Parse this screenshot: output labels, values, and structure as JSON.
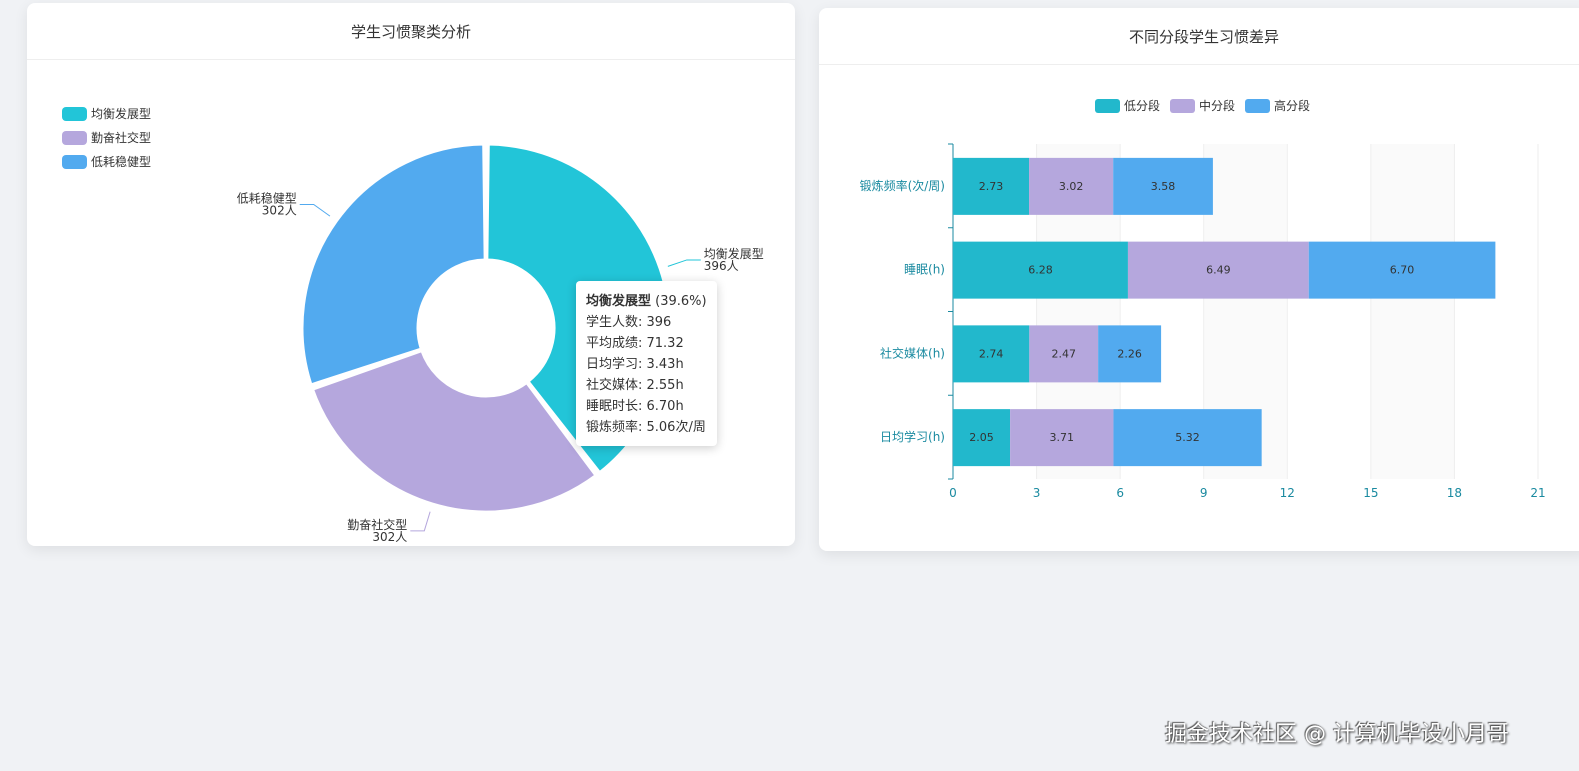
{
  "watermark": "掘金技术社区 @ 计算机毕设小月哥",
  "chart_data": [
    {
      "type": "pie",
      "title": "学生习惯聚类分析",
      "legend_position": "top-left",
      "slices": [
        {
          "name": "均衡发展型",
          "value": 396,
          "label": "396人",
          "color": "#22c5d8"
        },
        {
          "name": "勤奋社交型",
          "value": 302,
          "label": "302人",
          "color": "#b5a7dd"
        },
        {
          "name": "低耗稳健型",
          "value": 302,
          "label": "302人",
          "color": "#52aaef"
        }
      ],
      "tooltip": {
        "title": "均衡发展型",
        "percent": "(39.6%)",
        "lines": [
          "学生人数: 396",
          "平均成绩: 71.32",
          "日均学习: 3.43h",
          "社交媒体: 2.55h",
          "睡眠时长: 6.70h",
          "锻炼频率: 5.06次/周"
        ]
      }
    },
    {
      "type": "bar",
      "stacked": true,
      "orientation": "horizontal",
      "title": "不同分段学生习惯差异",
      "legend_position": "top",
      "categories": [
        "锻炼频率(次/周)",
        "睡眠(h)",
        "社交媒体(h)",
        "日均学习(h)"
      ],
      "series": [
        {
          "name": "低分段",
          "color": "#22b8cc",
          "values": [
            2.73,
            6.28,
            2.74,
            2.05
          ]
        },
        {
          "name": "中分段",
          "color": "#b5a7dd",
          "values": [
            3.02,
            6.49,
            2.47,
            3.71
          ]
        },
        {
          "name": "高分段",
          "color": "#52aaef",
          "values": [
            3.58,
            6.7,
            2.26,
            5.32
          ]
        }
      ],
      "xlim": [
        0,
        21
      ],
      "xticks": [
        "0",
        "3",
        "6",
        "9",
        "12",
        "15",
        "18",
        "21"
      ]
    }
  ]
}
